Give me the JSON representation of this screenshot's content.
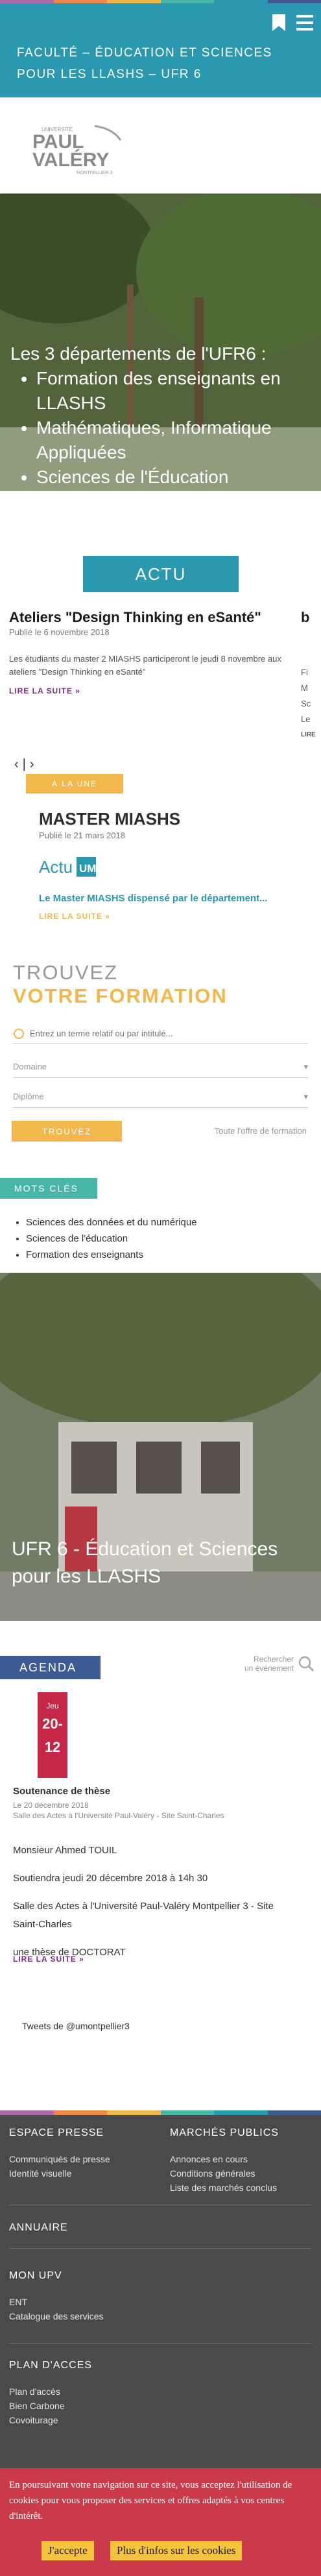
{
  "colors": {
    "header_teal": "#2a98ae",
    "accent_yellow": "#f2b84b",
    "agenda_blue": "#3d5b93",
    "keywords_green": "#48b7a7",
    "event_red": "#c62646",
    "footer_gray": "#4a4a4a",
    "cookie_red": "#ca3a4b",
    "cookie_button": "#f6c33d"
  },
  "header": {
    "title": "Faculté – Éducation et Sciences pour les LLASHS – UFR 6",
    "bookmark_icon": "bookmark-icon",
    "menu_icon": "hamburger-menu-icon"
  },
  "logo": {
    "line1": "UNIVERSITÉ",
    "line2": "PAUL",
    "line3": "VALÉRY",
    "line4": "MONTPELLIER 3"
  },
  "hero": {
    "heading": "Les 3 départements de l'UFR6 :",
    "items": [
      "Formation des enseignants en LLASHS",
      "Mathématiques, Informatique Appliquées",
      "Sciences de l'Éducation"
    ]
  },
  "actu": {
    "label": "ACTU",
    "featured": {
      "title": "Ateliers \"Design Thinking en eSanté\"",
      "date": "Publié le 6 novembre 2018",
      "text": "Les étudiants du master 2 MIASHS participeront le jeudi 8 novembre aux ateliers \"Design Thinking en eSanté\"",
      "more": "LIRE LA SUITE »"
    },
    "peek": {
      "title": "b",
      "lines": [
        "Fi",
        "M",
        "Sc",
        "Le",
        "LIRE"
      ]
    },
    "nav_prev": "‹",
    "nav_sep": "|",
    "nav_next": "›",
    "focus_label": "À LA UNE",
    "focus": {
      "title": "MASTER MIASHS",
      "date": "Publié le 21 mars 2018",
      "logo_text": "Actu",
      "logo_mark": "UM",
      "lead": "Le Master MIASHS dispensé par le département...",
      "more": "LIRE LA SUITE »"
    }
  },
  "find": {
    "title_line1": "TROUVEZ",
    "title_line2": "VOTRE FORMATION",
    "search_placeholder": "Entrez un terme relatif ou par intitulé...",
    "select_1": "Domaine",
    "select_2": "Diplôme",
    "button": "TROUVEZ",
    "link": "Toute l'offre de formation"
  },
  "keywords": {
    "label": "MOTS CLÉS",
    "items": [
      "Sciences des données et du numérique",
      "Sciences de l'éducation",
      "Formation des enseignants"
    ]
  },
  "building": {
    "caption": "UFR 6 - Éducation et Sciences pour les LLASHS"
  },
  "agenda": {
    "label": "AGENDA",
    "search_text_1": "Rechercher",
    "search_text_2": "un événement",
    "event": {
      "day_label": "Jeu",
      "day": "20-",
      "month": "12",
      "title": "Soutenance de thèse",
      "meta_date": "Le 20 décembre 2018",
      "meta_place": "Salle des Actes à l'Université Paul-Valéry - Site Saint-Charles",
      "speaker": "Monsieur Ahmed TOUIL",
      "when": "Soutiendra jeudi 20 décembre 2018 à 14h 30",
      "where": "Salle des Actes à l'Université Paul-Valéry Montpellier 3 - Site Saint-Charles",
      "role": "une thèse de DOCTORAT",
      "more": "LIRE LA SUITE »"
    }
  },
  "tweets": {
    "text": "Tweets de @umontpellier3"
  },
  "footer": {
    "col1": {
      "heading": "ESPACE PRESSE",
      "links": [
        "Communiqués de presse",
        "Identité visuelle"
      ]
    },
    "col2": {
      "heading": "MARCHÉS PUBLICS",
      "links": [
        "Annonces en cours",
        "Conditions générales",
        "Liste des marchés conclus"
      ]
    },
    "annuaire": "ANNUAIRE",
    "mon_upv": "MON UPV",
    "ent": "ENT",
    "catalogue": "Catalogue des services",
    "plan": {
      "heading": "PLAN D'ACCES",
      "links": [
        "Plan d'accès",
        "Bien Carbone",
        "Covoiturage"
      ]
    }
  },
  "cookie": {
    "text": "En poursuivant votre navigation sur ce site, vous acceptez l'utilisation de cookies pour vous proposer des services et offres adaptés à vos centres d'intérêt.",
    "accept": "J'accepte",
    "more": "Plus d'infos sur les cookies"
  }
}
